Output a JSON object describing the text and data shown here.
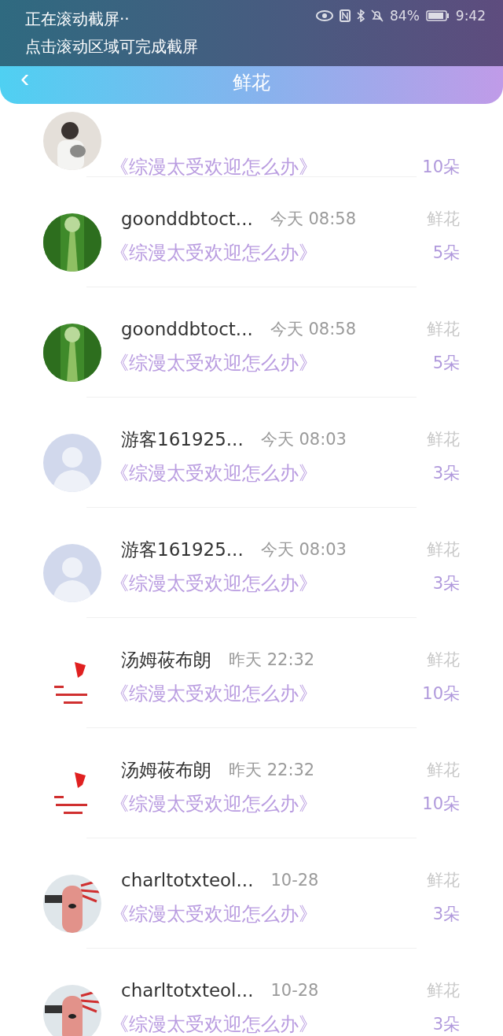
{
  "toast": {
    "title": "正在滚动截屏··",
    "hint": "点击滚动区域可完成截屏"
  },
  "status_bar": {
    "battery": "84%",
    "time": "9:42"
  },
  "nav": {
    "back": "‹",
    "title": "鲜花"
  },
  "rows": [
    {
      "kind": "partial",
      "book": "《综漫太受欢迎怎么办》",
      "count": "10朵"
    },
    {
      "kind": "full",
      "name": "goonddbtoct...",
      "time": "今天 08:58",
      "label": "鲜花",
      "book": "《综漫太受欢迎怎么办》",
      "count": "5朵"
    },
    {
      "kind": "full",
      "name": "goonddbtoct...",
      "time": "今天 08:58",
      "label": "鲜花",
      "book": "《综漫太受欢迎怎么办》",
      "count": "5朵"
    },
    {
      "kind": "full",
      "avatar": {
        "kind": "default"
      },
      "name": "游客161925...",
      "time": "今天 08:03",
      "label": "鲜花",
      "book": "《综漫太受欢迎怎么办》",
      "count": "3朵"
    },
    {
      "kind": "full",
      "avatar": {
        "kind": "default"
      },
      "name": "游客161925...",
      "time": "今天 08:03",
      "label": "鲜花",
      "book": "《综漫太受欢迎怎么办》",
      "count": "3朵"
    },
    {
      "kind": "full",
      "name": "汤姆莜布朗",
      "time": "昨天 22:32",
      "label": "鲜花",
      "book": "《综漫太受欢迎怎么办》",
      "count": "10朵"
    },
    {
      "kind": "full",
      "name": "汤姆莜布朗",
      "time": "昨天 22:32",
      "label": "鲜花",
      "book": "《综漫太受欢迎怎么办》",
      "count": "10朵"
    },
    {
      "kind": "full",
      "name": "charltotxteol...",
      "time": "10-28",
      "label": "鲜花",
      "book": "《综漫太受欢迎怎么办》",
      "count": "3朵"
    },
    {
      "kind": "full",
      "name": "charltotxteol...",
      "time": "10-28",
      "label": "鲜花",
      "book": "《综漫太受欢迎怎么办》",
      "count": "3朵"
    }
  ]
}
